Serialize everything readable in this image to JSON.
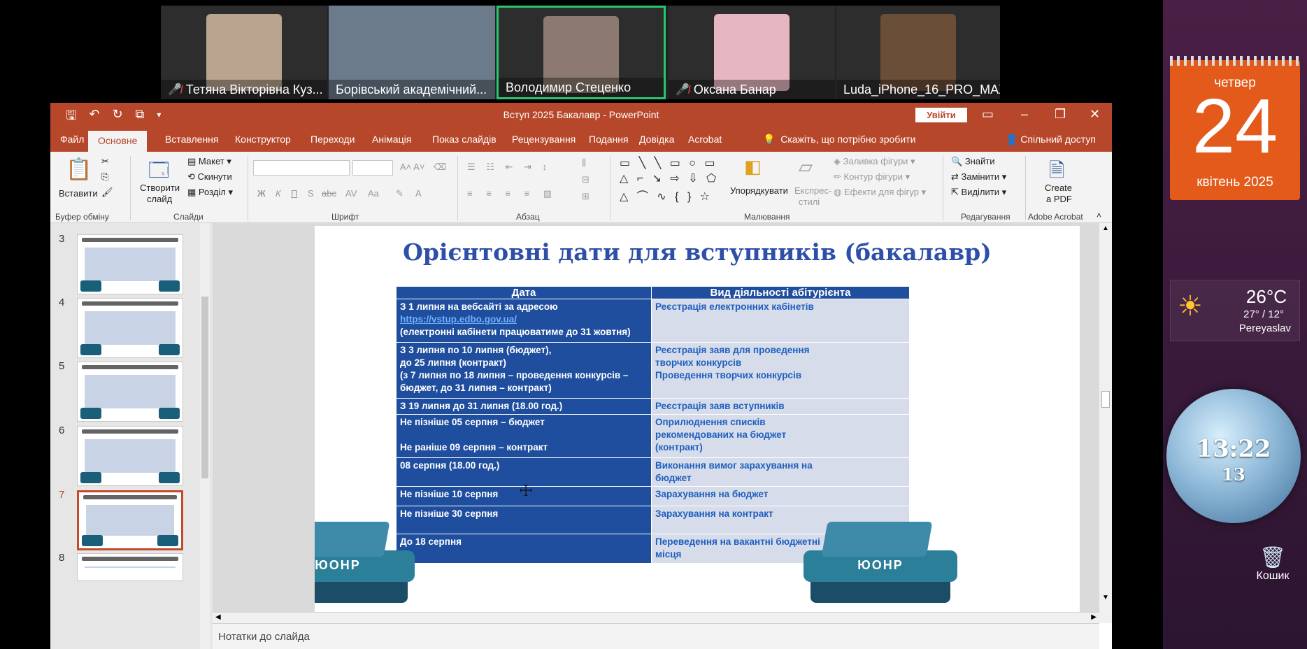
{
  "participants": [
    {
      "name": "Тетяна Вікторівна Куз...",
      "muted": true,
      "active": false,
      "cam": "#b9a490"
    },
    {
      "name": "Борівський академічний...",
      "muted": false,
      "active": false,
      "cam": "#6b7b8c"
    },
    {
      "name": "Володимир Стеценко",
      "muted": false,
      "active": true,
      "cam": "#8c7a70"
    },
    {
      "name": "Оксана Банар",
      "muted": true,
      "active": false,
      "cam": "#e6b7c2"
    },
    {
      "name": "Luda_iPhone_16_PRO_MAX",
      "muted": false,
      "active": false,
      "cam": "#6a4e38"
    }
  ],
  "window": {
    "title": "Вступ 2025 Бакалавр  -  PowerPoint",
    "signin": "Увійти"
  },
  "tabs": [
    "Файл",
    "Основне",
    "Вставлення",
    "Конструктор",
    "Переходи",
    "Анімація",
    "Показ слайдів",
    "Рецензування",
    "Подання",
    "Довідка",
    "Acrobat"
  ],
  "tell_me": "Скажіть, що потрібно зробити",
  "share": "Спільний доступ",
  "ribbon": {
    "clipboard": {
      "paste": "Вставити",
      "label": "Буфер обміну"
    },
    "slides": {
      "new": "Створити",
      "new2": "слайд",
      "layout": "Макет",
      "reset": "Скинути",
      "section": "Розділ",
      "label": "Слайди"
    },
    "font": {
      "label": "Шрифт",
      "bold": "Ж",
      "italic": "К",
      "underline": "П",
      "shadow": "S",
      "strike": "abc",
      "spacing": "AV",
      "case": "Aa"
    },
    "paragraph": {
      "label": "Абзац"
    },
    "drawing": {
      "arrange": "Упорядкувати",
      "styles": "Експрес-",
      "styles2": "стилі",
      "fill": "Заливка фігури",
      "outline": "Контур фігури",
      "effects": "Ефекти для фігур",
      "label": "Малювання"
    },
    "editing": {
      "find": "Знайти",
      "replace": "Замінити",
      "select": "Виділити",
      "label": "Редагування"
    },
    "acrobat": {
      "create": "Create",
      "create2": "a PDF",
      "label": "Adobe Acrobat"
    }
  },
  "thumbnails": [
    {
      "num": "3",
      "title": "Дуальна підготовка фахівців за певними спеціальностями та освітніми програмами"
    },
    {
      "num": "4",
      "title": "НОВІ ОСВІТНЬО-ПРОФЕСІЙНІ ПРОГРАМИ (бакалавр)"
    },
    {
      "num": "5",
      "title": "Вступ на основі"
    },
    {
      "num": "6",
      "title": "Калейдоскоп НМТ 2025"
    },
    {
      "num": "7",
      "title": "Орієнтовні дати для вступника (бакалавр)"
    },
    {
      "num": "8",
      "title": "Мотиваційний лист"
    }
  ],
  "slide": {
    "title": "Орієнтовні дати для вступників (бакалавр)",
    "col1": "Дата",
    "col2": "Вид діяльності абітурієнта",
    "rows": [
      {
        "date": [
          "З 1 липня  на вебсайті за адресою",
          "https://vstup.edbo.gov.ua/",
          "(електронні кабінети працюватиме до 31 жовтня)"
        ],
        "activity": [
          "Реєстрація електронних кабінетів"
        ]
      },
      {
        "date": [
          "З 3 липня по 10 липня (бюджет),",
          "до 25 липня (контракт)",
          "(з 7 липня по 18 липня – проведення конкурсів –",
          "бюджет, до 31 липня – контракт)"
        ],
        "activity": [
          "Реєстрація заяв для проведення",
          "творчих конкурсів",
          "Проведення творчих конкурсів"
        ]
      },
      {
        "date": [
          "З 19 липня до 31 липня (18.00 год.)"
        ],
        "activity": [
          "Реєстрація заяв вступників"
        ]
      },
      {
        "date": [
          "Не пізніше 05 серпня – бюджет",
          "",
          "Не раніше 09 серпня – контракт"
        ],
        "activity": [
          "Оприлюднення списків",
          "рекомендованих на бюджет",
          "(контракт)"
        ]
      },
      {
        "date": [
          "08 серпня (18.00 год.)"
        ],
        "activity": [
          "Виконання вимог зарахування на",
          "бюджет"
        ]
      },
      {
        "date": [
          "Не пізніше 10 серпня"
        ],
        "activity": [
          "Зарахування на бюджет"
        ]
      },
      {
        "date": [
          "Не пізніше 30 серпня"
        ],
        "activity": [
          "Зарахування на контракт"
        ]
      },
      {
        "date": [
          "До 18 серпня"
        ],
        "activity": [
          "Переведення на вакантні бюджетні",
          "місця"
        ]
      }
    ],
    "book_label": "ЮОНР"
  },
  "notes": "Нотатки до слайда",
  "calendar": {
    "day": "четвер",
    "date": "24",
    "month": "квітень 2025"
  },
  "weather": {
    "temp": "26°C",
    "range": "27° / 12°",
    "city": "Pereyaslav"
  },
  "clock": {
    "time": "13:22",
    "seconds": "13"
  },
  "recycle": "Кошик"
}
